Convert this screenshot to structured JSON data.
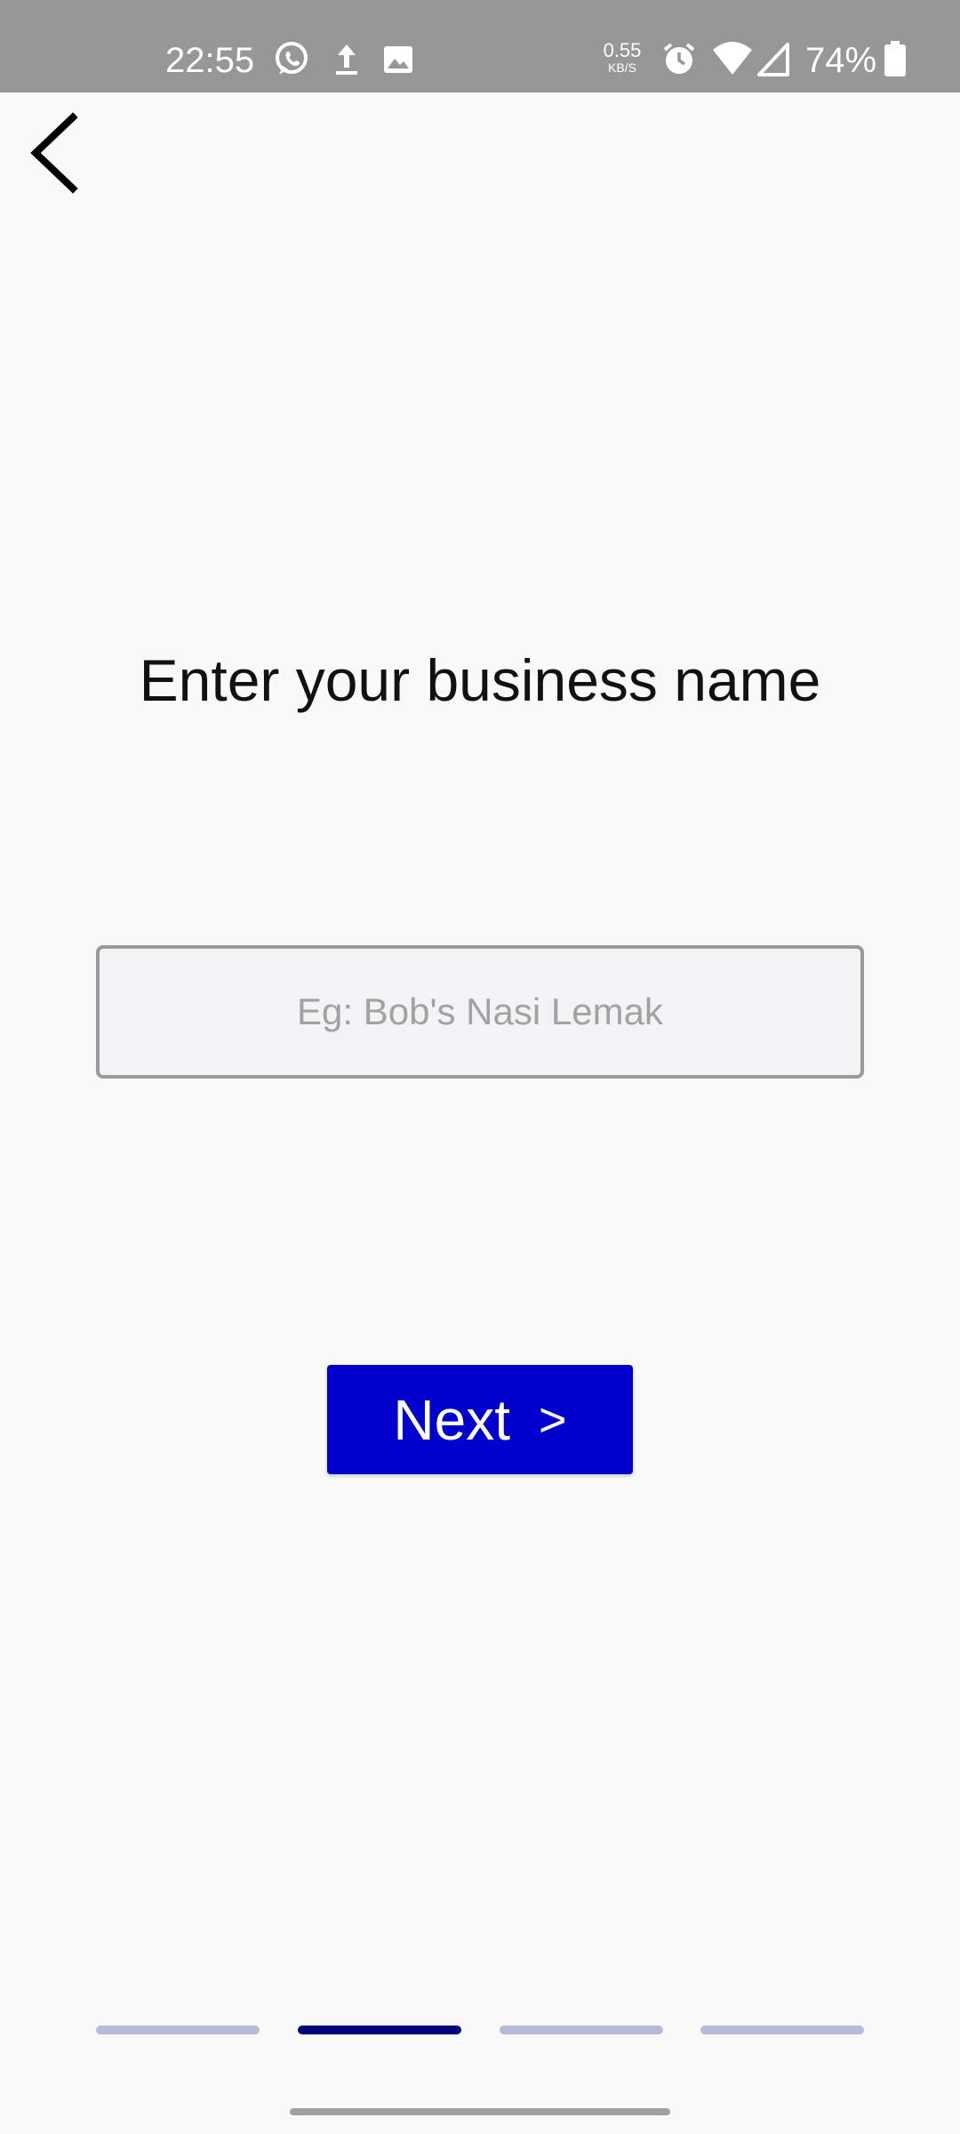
{
  "status_bar": {
    "time": "22:55",
    "net_speed_value": "0.55",
    "net_speed_unit": "KB/S",
    "battery_percent": "74%",
    "icons": [
      "whatsapp-icon",
      "upload-icon",
      "gallery-icon",
      "alarm-icon",
      "wifi-icon",
      "cell-signal-icon",
      "battery-icon"
    ],
    "background_color": "#979797"
  },
  "nav": {
    "back_icon": "chevron-left-icon"
  },
  "main": {
    "heading": "Enter your business name",
    "input": {
      "value": "",
      "placeholder": "Eg: Bob's Nasi Lemak"
    },
    "next_button": {
      "label": "Next",
      "arrow": ">",
      "color": "#0000cc"
    }
  },
  "progress": {
    "total_steps": 4,
    "current_step": 2,
    "active_color": "#00007a",
    "inactive_color": "#b6b9d8"
  }
}
